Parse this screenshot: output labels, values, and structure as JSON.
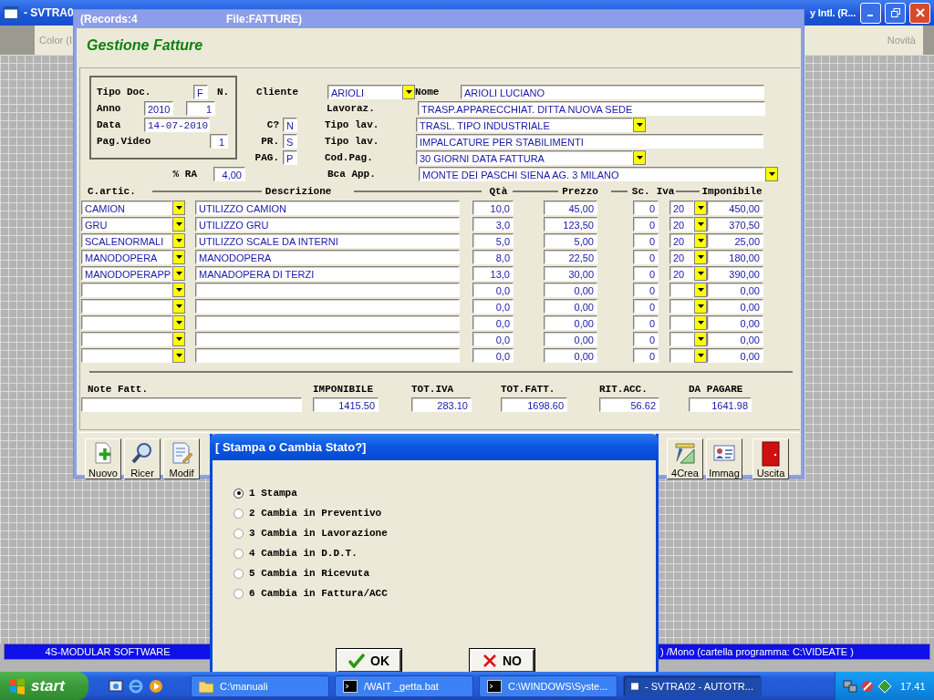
{
  "app_window": {
    "title_start": "- SVTRA0",
    "title_end": "y Intl. (R...",
    "toolbar_left": "Color (I",
    "toolbar_right": "Novità",
    "status_left": "4S-MODULAR SOFTWARE",
    "status_right": ") /Mono  (cartella programma: C:\\VIDEATE )"
  },
  "form_window": {
    "title_records": "(Records:4",
    "title_file": "File:FATTURE)",
    "heading": "Gestione Fatture",
    "doc_box": {
      "tipo_doc_label": "Tipo Doc.",
      "tipo_doc": "F",
      "n_label": "N.",
      "anno_label": "Anno",
      "anno": "2010",
      "number": "1",
      "data_label": "Data",
      "data": "14-07-2010",
      "pag_video_label": "Pag.Video",
      "pag_video": "1"
    },
    "cliente": {
      "label": "Cliente",
      "value": "ARIOLI"
    },
    "nome": {
      "label": "Nome",
      "value": "ARIOLI LUCIANO"
    },
    "details": [
      {
        "label": "Lavoraz.",
        "value": "TRASP.APPARECCHIAT. DITTA NUOVA SEDE",
        "kind": "text"
      },
      {
        "flag_label": "C?",
        "flag_value": "N",
        "label": "Tipo lav.",
        "value": "TRASL. TIPO INDUSTRIALE",
        "kind": "dropdown"
      },
      {
        "flag_label": "PR.",
        "flag_value": "S",
        "label": "Tipo lav.",
        "value": "IMPALCATURE  PER STABILIMENTI",
        "kind": "text"
      },
      {
        "flag_label": "PAG.",
        "flag_value": "P",
        "label": "Cod.Pag.",
        "value": "30 GIORNI DATA FATTURA",
        "kind": "dropdown"
      }
    ],
    "ra": {
      "label": "% RA",
      "value": "4,00"
    },
    "bank": {
      "label": "Bca App.",
      "value": "MONTE DEI PASCHI SIENA  AG. 3  MILANO"
    },
    "columns": [
      "C.artic.",
      "Descrizione",
      "Qtà",
      "Prezzo",
      "Sc.",
      "Iva",
      "Imponibile"
    ],
    "rows": [
      {
        "code": "CAMION",
        "description": "UTILIZZO CAMION",
        "qty": "10,0",
        "price": "45,00",
        "discount": "0",
        "vat": "20",
        "amount": "450,00"
      },
      {
        "code": "GRU",
        "description": "UTILIZZO GRU",
        "qty": "3,0",
        "price": "123,50",
        "discount": "0",
        "vat": "20",
        "amount": "370,50"
      },
      {
        "code": "SCALENORMALI",
        "description": "UTILIZZO SCALE DA INTERNI",
        "qty": "5,0",
        "price": "5,00",
        "discount": "0",
        "vat": "20",
        "amount": "25,00"
      },
      {
        "code": "MANODOPERA",
        "description": "MANODOPERA",
        "qty": "8,0",
        "price": "22,50",
        "discount": "0",
        "vat": "20",
        "amount": "180,00"
      },
      {
        "code": "MANODOPERAPP",
        "description": "MANADOPERA DI TERZI",
        "qty": "13,0",
        "price": "30,00",
        "discount": "0",
        "vat": "20",
        "amount": "390,00"
      },
      {
        "qty": "0,0",
        "price": "0,00",
        "discount": "0",
        "amount": "0,00"
      },
      {
        "qty": "0,0",
        "price": "0,00",
        "discount": "0",
        "amount": "0,00"
      },
      {
        "qty": "0,0",
        "price": "0,00",
        "discount": "0",
        "amount": "0,00"
      },
      {
        "qty": "0,0",
        "price": "0,00",
        "discount": "0",
        "amount": "0,00"
      },
      {
        "qty": "0,0",
        "price": "0,00",
        "discount": "0",
        "amount": "0,00"
      }
    ],
    "note_label": "Note Fatt.",
    "totals": [
      {
        "label": "IMPONIBILE",
        "value": "1415.50"
      },
      {
        "label": "TOT.IVA",
        "value": "283.10"
      },
      {
        "label": "TOT.FATT.",
        "value": "1698.60"
      },
      {
        "label": "RIT.ACC.",
        "value": "56.62"
      },
      {
        "label": "DA PAGARE",
        "value": "1641.98"
      }
    ],
    "toolbar": [
      {
        "label": "Nuovo",
        "kind": "new"
      },
      {
        "label": "Ricer",
        "kind": "search"
      },
      {
        "label": "Modif",
        "kind": "edit"
      },
      {
        "label": "4Crea",
        "kind": "create"
      },
      {
        "label": "Immag",
        "kind": "image"
      },
      {
        "label": "Uscita",
        "kind": "exit"
      }
    ]
  },
  "dialog": {
    "title": "[ Stampa o Cambia Stato?]",
    "options": [
      {
        "label": "1 Stampa",
        "selected": true
      },
      {
        "label": "2 Cambia in Preventivo",
        "selected": false
      },
      {
        "label": "3 Cambia in Lavorazione",
        "selected": false
      },
      {
        "label": "4 Cambia in D.D.T.",
        "selected": false
      },
      {
        "label": "5 Cambia in Ricevuta",
        "selected": false
      },
      {
        "label": "6 Cambia in Fattura/ACC",
        "selected": false
      }
    ],
    "buttons": [
      {
        "label": "OK",
        "kind": "ok"
      },
      {
        "label": "NO",
        "kind": "no"
      }
    ]
  },
  "taskbar": {
    "start": "start",
    "tasks": [
      {
        "label": "C:\\manuali",
        "kind": "folder",
        "selected": false
      },
      {
        "label": "/WAIT _getta.bat",
        "kind": "console",
        "selected": false
      },
      {
        "label": "C:\\WINDOWS\\Syste...",
        "kind": "console",
        "selected": false
      },
      {
        "label": "- SVTRA02 - AUTOTR...",
        "kind": "window",
        "selected": true
      }
    ],
    "clock": "17.41"
  }
}
